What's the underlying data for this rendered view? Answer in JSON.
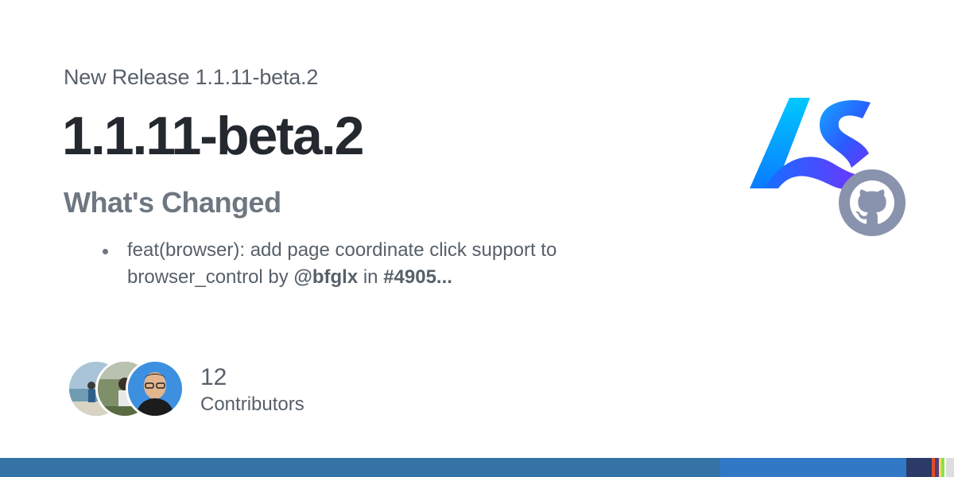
{
  "release": {
    "eyebrow": "New Release 1.1.11-beta.2",
    "title": "1.1.11-beta.2",
    "section_heading": "What's Changed",
    "changes": [
      {
        "text_before": "feat(browser): add page coordinate click support to browser_control by ",
        "author": "@bfglx",
        "text_middle": " in ",
        "pr": "#4905..."
      }
    ]
  },
  "contributors": {
    "count": "12",
    "label": "Contributors",
    "avatars": [
      "avatar-beach",
      "avatar-outdoor",
      "avatar-portrait"
    ]
  },
  "logo": {
    "name": "as-logo",
    "colors": [
      "#00c2ff",
      "#1a6cff",
      "#6a3cff"
    ]
  },
  "github_badge": {
    "icon": "github-icon",
    "color": "#8a93ad"
  },
  "language_bar": [
    {
      "color": "#3572a5",
      "share": 0.755
    },
    {
      "color": "#3178c6",
      "share": 0.195
    },
    {
      "color": "#2b3a67",
      "share": 0.027
    },
    {
      "color": "#e34c26",
      "share": 0.003
    },
    {
      "color": "#563d7c",
      "share": 0.004
    },
    {
      "color": "#f1e05a",
      "share": 0.003
    },
    {
      "color": "#89e051",
      "share": 0.003
    },
    {
      "color": "#ffffff",
      "share": 0.002
    },
    {
      "color": "#dddddd",
      "share": 0.008
    }
  ]
}
